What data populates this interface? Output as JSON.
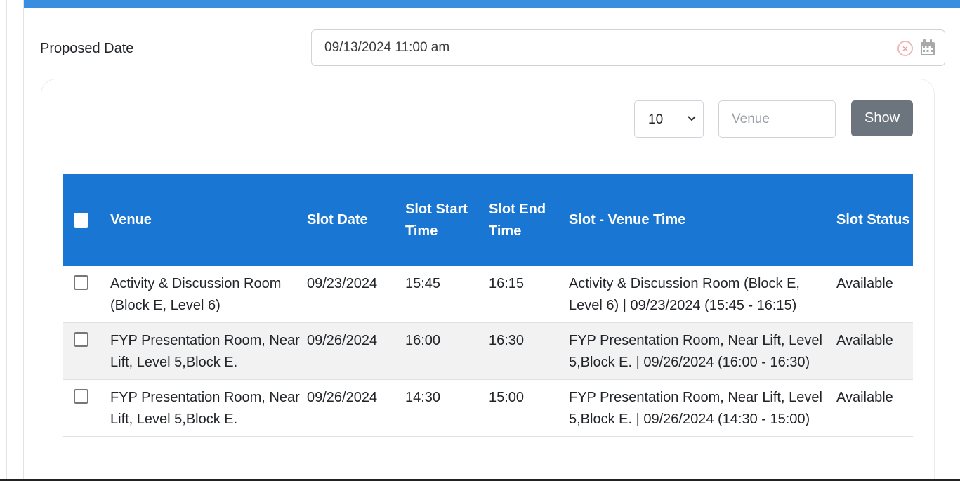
{
  "form": {
    "proposed_date_label": "Proposed Date",
    "proposed_date_value": "09/13/2024 11:00 am"
  },
  "controls": {
    "page_size_value": "10",
    "venue_placeholder": "Venue",
    "show_label": "Show"
  },
  "table": {
    "headers": {
      "venue": "Venue",
      "slot_date": "Slot Date",
      "slot_start_time": "Slot Start Time",
      "slot_end_time": "Slot End Time",
      "slot_venue_time": "Slot - Venue Time",
      "slot_status": "Slot Status"
    },
    "rows": [
      {
        "venue": "Activity & Discussion Room (Block E, Level 6)",
        "slot_date": "09/23/2024",
        "start": "15:45",
        "end": "16:15",
        "venue_time": "Activity & Discussion Room (Block E, Level 6) | 09/23/2024 (15:45 - 16:15)",
        "status": "Available"
      },
      {
        "venue": "FYP Presentation Room, Near Lift, Level 5,Block E.",
        "slot_date": "09/26/2024",
        "start": "16:00",
        "end": "16:30",
        "venue_time": "FYP Presentation Room, Near Lift, Level 5,Block E. | 09/26/2024 (16:00 - 16:30)",
        "status": "Available"
      },
      {
        "venue": "FYP Presentation Room, Near Lift, Level 5,Block E.",
        "slot_date": "09/26/2024",
        "start": "14:30",
        "end": "15:00",
        "venue_time": "FYP Presentation Room, Near Lift, Level 5,Block E. | 09/26/2024 (14:30 - 15:00)",
        "status": "Available"
      }
    ]
  },
  "colors": {
    "top_bar": "#3a8ee0",
    "table_header": "#1976d2",
    "show_button": "#6c757d"
  },
  "icons": {
    "clear": "clear-icon",
    "calendar": "calendar-icon",
    "dropdown": "chevron-down-icon"
  }
}
